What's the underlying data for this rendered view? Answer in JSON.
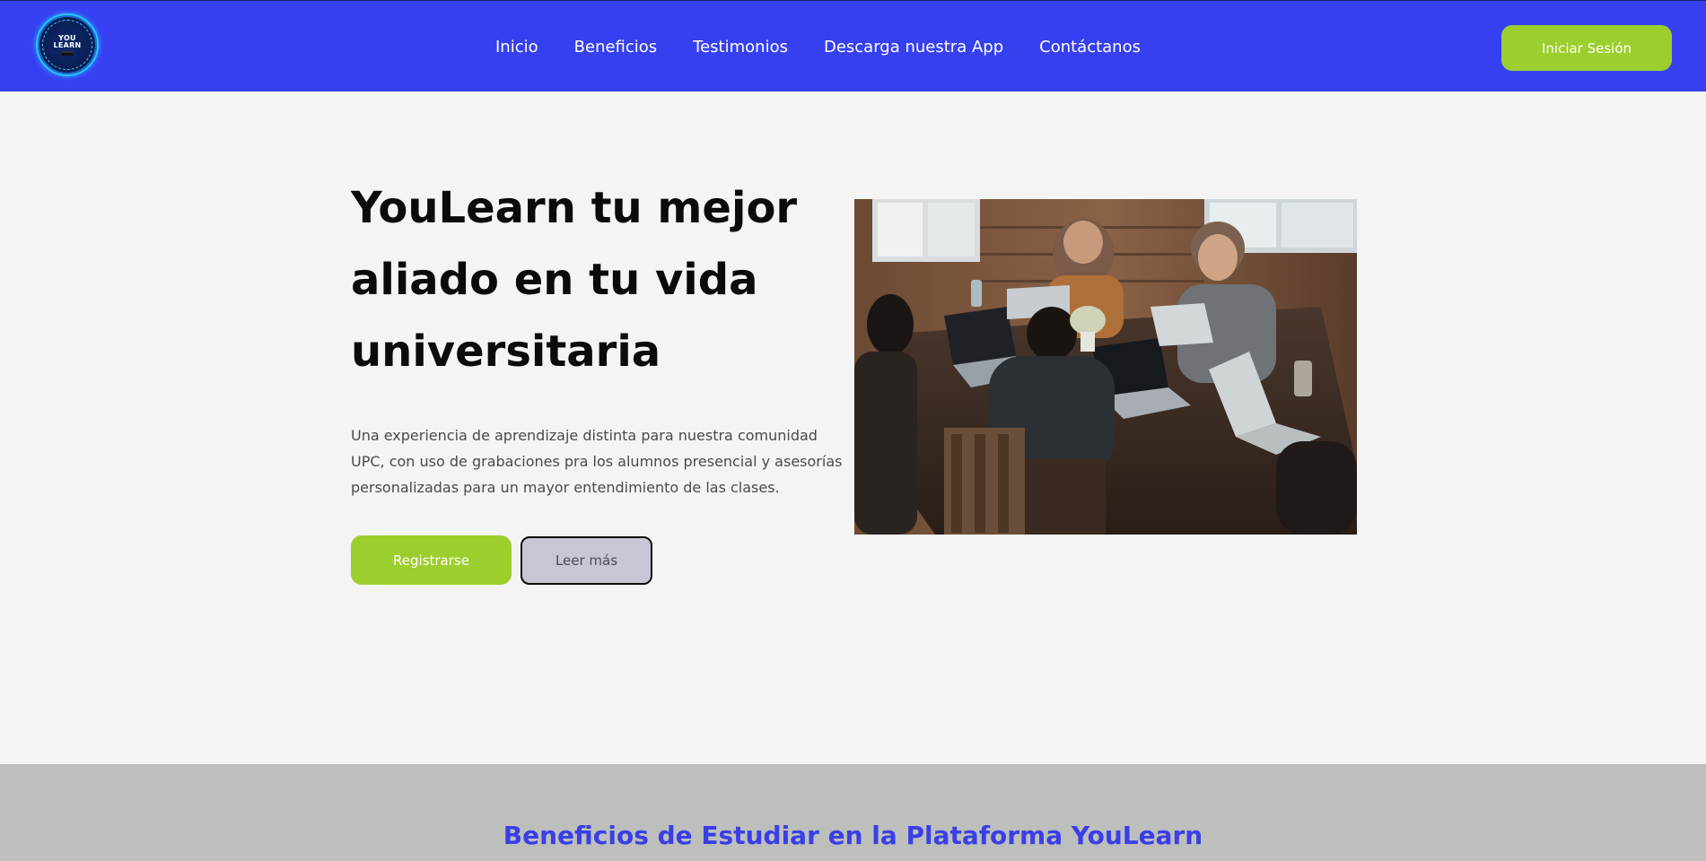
{
  "header": {
    "logo_text_top": "YOU",
    "logo_text_bottom": "LEARN",
    "nav": [
      {
        "label": "Inicio"
      },
      {
        "label": "Beneficios"
      },
      {
        "label": "Testimonios"
      },
      {
        "label": "Descarga nuestra App"
      },
      {
        "label": "Contáctanos"
      }
    ],
    "login_label": "Iniciar Sesión"
  },
  "hero": {
    "title": "YouLearn tu mejor aliado en tu vida universitaria",
    "text": "Una experiencia de aprendizaje distinta para nuestra comunidad UPC, con uso de grabaciones pra los alumnos presencial y asesorías personalizadas para un mayor entendimiento de las clases.",
    "register_label": "Registrarse",
    "more_label": "Leer más"
  },
  "benefits": {
    "title": "Beneficios de Estudiar en la Plataforma YouLearn"
  },
  "colors": {
    "header_bg": "#3640f0",
    "accent_green": "#9cce2e",
    "benefits_title": "#3a3ee8",
    "page_bg": "#f4f4f4",
    "band_bg": "#bcbfbc"
  }
}
